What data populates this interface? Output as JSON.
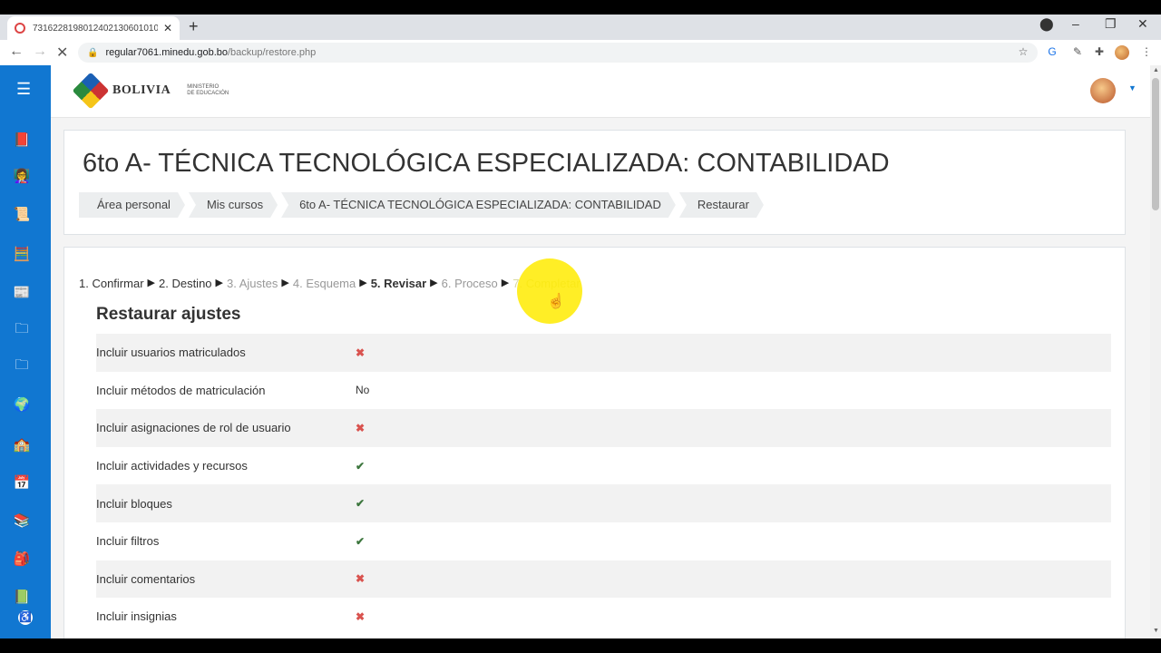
{
  "browser": {
    "tab_title": "731622819801240213060101039",
    "url_host": "regular7061.minedu.gob.bo",
    "url_path": "/backup/restore.php"
  },
  "site": {
    "logo_text": "BOLIVIA",
    "logo_subtext_1": "MINISTERIO",
    "logo_subtext_2": "DE EDUCACIÓN"
  },
  "sidebar": {
    "items": [
      {
        "icon": "notebook-icon",
        "glyph": "📕"
      },
      {
        "icon": "teacher-icon",
        "glyph": "👩‍🏫"
      },
      {
        "icon": "diploma-icon",
        "glyph": "📜"
      },
      {
        "icon": "abacus-icon",
        "glyph": "🧮"
      },
      {
        "icon": "document-icon",
        "glyph": "📰"
      },
      {
        "icon": "folder-icon",
        "glyph": "🗀"
      },
      {
        "icon": "folder-icon",
        "glyph": "🗀"
      },
      {
        "icon": "globe-icon",
        "glyph": "🌍"
      },
      {
        "icon": "school-icon",
        "glyph": "🏫"
      },
      {
        "icon": "calendar-icon",
        "glyph": "📅"
      },
      {
        "icon": "books-icon",
        "glyph": "📚"
      },
      {
        "icon": "backpack-icon",
        "glyph": "🎒"
      },
      {
        "icon": "book-icon",
        "glyph": "📗"
      }
    ]
  },
  "page": {
    "title": "6to A- TÉCNICA TECNOLÓGICA ESPECIALIZADA: CONTABILIDAD",
    "breadcrumb": [
      "Área personal",
      "Mis cursos",
      "6to A- TÉCNICA TECNOLÓGICA ESPECIALIZADA: CONTABILIDAD",
      "Restaurar"
    ]
  },
  "restore": {
    "steps": [
      {
        "label": "1. Confirmar",
        "state": "done"
      },
      {
        "label": "2. Destino",
        "state": "done"
      },
      {
        "label": "3. Ajustes",
        "state": "dim"
      },
      {
        "label": "4. Esquema",
        "state": "dim"
      },
      {
        "label": "5. Revisar",
        "state": "current"
      },
      {
        "label": "6. Proceso",
        "state": "dim"
      },
      {
        "label": "7. Completar",
        "state": "faint"
      }
    ],
    "section_title": "Restaurar ajustes",
    "settings": [
      {
        "label": "Incluir usuarios matriculados",
        "value": "✖",
        "kind": "no"
      },
      {
        "label": "Incluir métodos de matriculación",
        "value": "No",
        "kind": "text"
      },
      {
        "label": "Incluir asignaciones de rol de usuario",
        "value": "✖",
        "kind": "no"
      },
      {
        "label": "Incluir actividades y recursos",
        "value": "✔",
        "kind": "yes"
      },
      {
        "label": "Incluir bloques",
        "value": "✔",
        "kind": "yes"
      },
      {
        "label": "Incluir filtros",
        "value": "✔",
        "kind": "yes"
      },
      {
        "label": "Incluir comentarios",
        "value": "✖",
        "kind": "no"
      },
      {
        "label": "Incluir insignias",
        "value": "✖",
        "kind": "no"
      }
    ]
  },
  "colors": {
    "sidebar": "#1177d1",
    "no_mark": "#d9534f",
    "yes_mark": "#3c763d"
  }
}
